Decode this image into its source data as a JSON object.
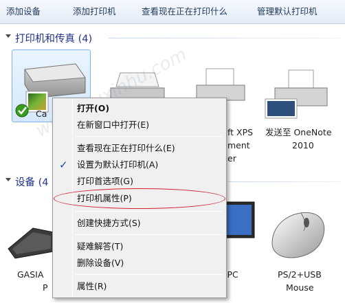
{
  "toolbar": {
    "add_device": "添加设备",
    "add_printer": "添加打印机",
    "see_printing": "查看现在正在打印什么",
    "manage_default": "管理默认打印机"
  },
  "printers_group": {
    "title": "打印机和传真 (4)"
  },
  "devices_group": {
    "title": "设备 (4"
  },
  "tiles": {
    "canon": {
      "label": "Ca"
    },
    "xps_line1": "ft XPS",
    "xps_line2": "ment",
    "xps_line3": "er",
    "onenote_line1": "发送至 OneNote",
    "onenote_line2": "2010",
    "gasia_line1": "GASIA",
    "gasia_line2": "P",
    "pc": "-PC",
    "mouse_line1": "PS/2+USB",
    "mouse_line2": "Mouse"
  },
  "context_menu": {
    "items": [
      {
        "label": "打开(O)"
      },
      {
        "label": "在新窗口中打开(E)"
      },
      {
        "label": "查看现在正在打印什么(E)"
      },
      {
        "label": "设置为默认打印机(A)"
      },
      {
        "label": "打印首选项(G)"
      },
      {
        "label": "打印机属性(P)"
      },
      {
        "label": "创建快捷方式(S)"
      },
      {
        "label": "疑难解答(T)"
      },
      {
        "label": "删除设备(V)"
      },
      {
        "label": "属性(R)"
      }
    ],
    "checked_item": "设置为默认打印机(A)"
  },
  "watermark": "www.wuxinhu.com",
  "colors": {
    "accent": "#1e3287",
    "highlight_ellipse": "#d21f2f",
    "selection": "#d5e8fb"
  }
}
